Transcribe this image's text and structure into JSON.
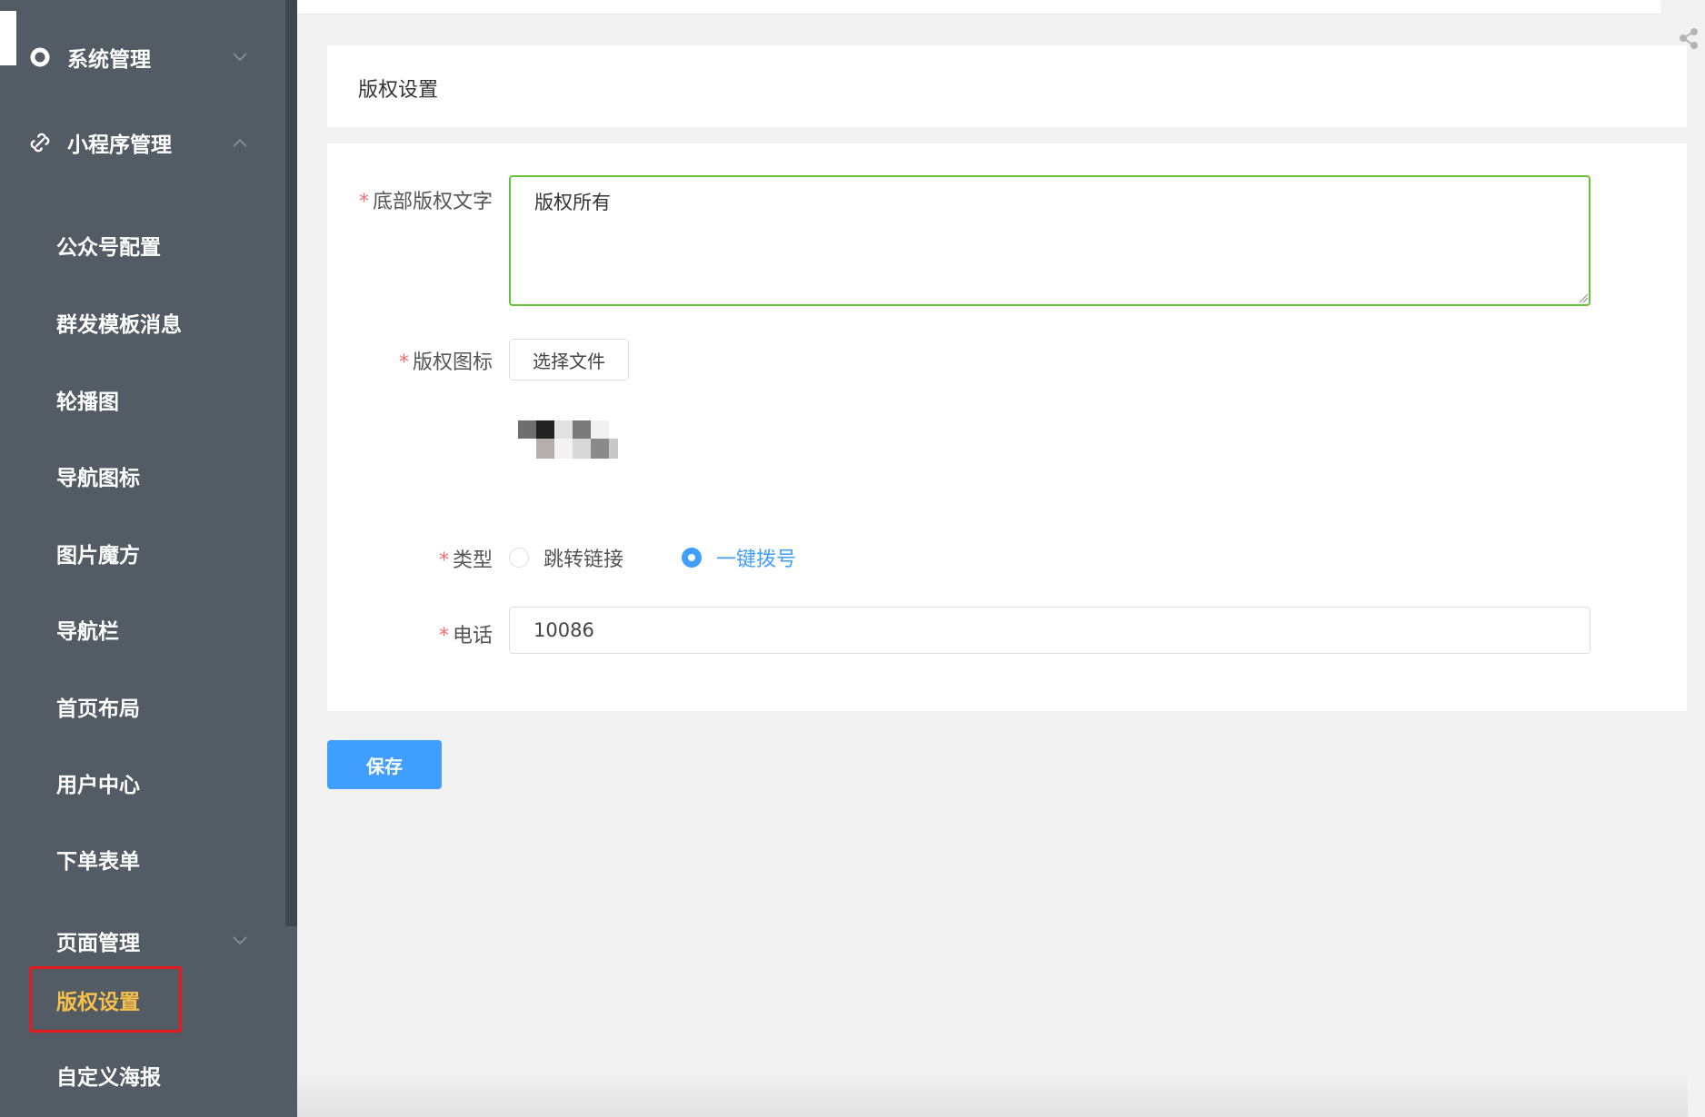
{
  "sidebar": {
    "groups": [
      {
        "label": "系统管理",
        "icon": "gear-circle-icon",
        "expanded": false
      },
      {
        "label": "小程序管理",
        "icon": "link-icon",
        "expanded": true
      }
    ],
    "items": [
      {
        "label": "公众号配置"
      },
      {
        "label": "群发模板消息"
      },
      {
        "label": "轮播图"
      },
      {
        "label": "导航图标"
      },
      {
        "label": "图片魔方"
      },
      {
        "label": "导航栏"
      },
      {
        "label": "首页布局"
      },
      {
        "label": "用户中心"
      },
      {
        "label": "下单表单"
      },
      {
        "label": "页面管理"
      },
      {
        "label": "版权设置",
        "active": true
      },
      {
        "label": "自定义海报"
      }
    ]
  },
  "header": {
    "title": "版权设置"
  },
  "form": {
    "copyright_text": {
      "label": "底部版权文字",
      "value": "版权所有"
    },
    "copyright_icon": {
      "label": "版权图标",
      "button_label": "选择文件"
    },
    "type": {
      "label": "类型",
      "options": [
        {
          "label": "跳转链接",
          "checked": false
        },
        {
          "label": "一键拨号",
          "checked": true
        }
      ]
    },
    "phone": {
      "label": "电话",
      "value": "10086"
    }
  },
  "actions": {
    "save_label": "保存"
  },
  "colors": {
    "sidebar_bg": "#535c65",
    "active_text": "#f7c04a",
    "primary": "#409eff",
    "required": "#f56c6c",
    "focus_border": "#67c23a",
    "highlight_box": "#e6191f"
  }
}
